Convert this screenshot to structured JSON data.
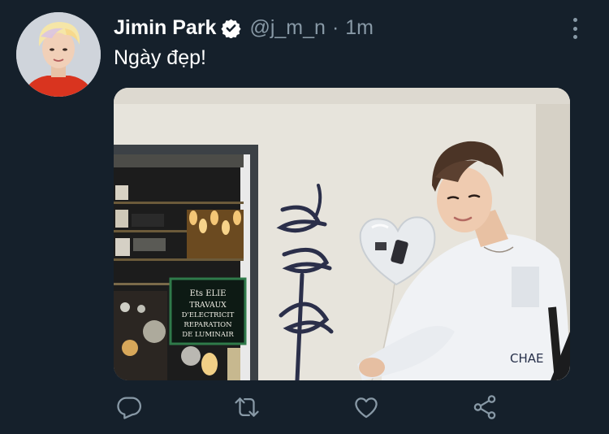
{
  "tweet": {
    "display_name": "Jimin Park",
    "handle": "@j_m_n",
    "separator": "·",
    "time": "1m",
    "text": "Ngày đẹp!",
    "verified": true
  },
  "media": {
    "sign_lines": [
      "Ets ELIE",
      "TRAVAUX",
      "D'ELECTRICIT",
      "REPARATION",
      "DE LUMINAIR"
    ],
    "shirt_text": "CHAE"
  },
  "actions": [
    {
      "icon": "reply-icon"
    },
    {
      "icon": "retweet-icon"
    },
    {
      "icon": "like-icon"
    },
    {
      "icon": "share-icon"
    }
  ],
  "colors": {
    "background": "#15202b",
    "text_primary": "#ffffff",
    "text_secondary": "#8899a6",
    "icon": "#8899a6"
  }
}
